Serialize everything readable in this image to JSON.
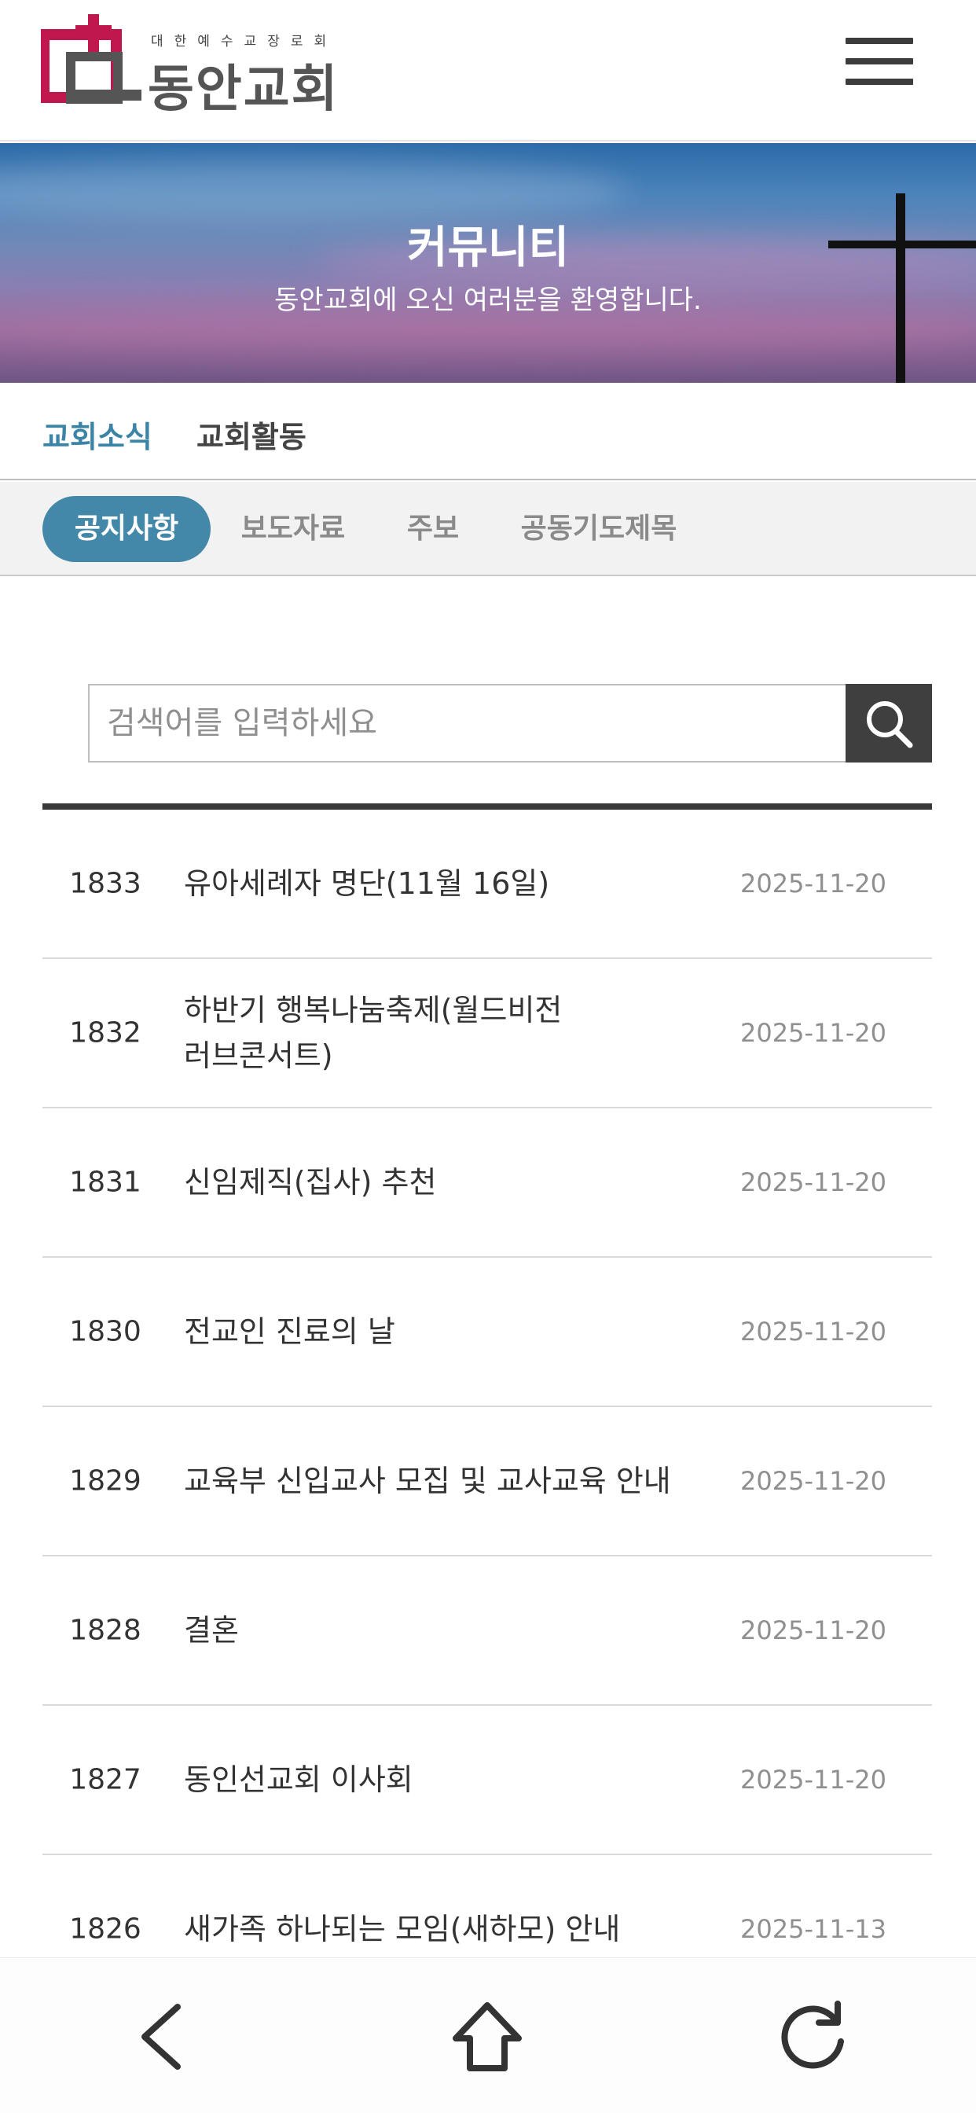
{
  "header": {
    "logo_small_text": "대한예수교장로회",
    "logo_text": "동안교회",
    "menu_icon": "hamburger-menu-icon"
  },
  "banner": {
    "title": "커뮤니티",
    "subtitle": "동안교회에 오신 여러분을 환영합니다."
  },
  "primary_tabs": [
    {
      "label": "교회소식",
      "active": true
    },
    {
      "label": "교회활동",
      "active": false
    }
  ],
  "secondary_tabs": [
    {
      "label": "공지사항",
      "active": true
    },
    {
      "label": "보도자료",
      "active": false
    },
    {
      "label": "주보",
      "active": false
    },
    {
      "label": "공동기도제목",
      "active": false
    }
  ],
  "search": {
    "placeholder": "검색어를 입력하세요",
    "icon": "search-icon"
  },
  "notices": [
    {
      "no": "1833",
      "title": "유아세례자 명단(11월 16일)",
      "date": "2025-11-20"
    },
    {
      "no": "1832",
      "title": "하반기 행복나눔축제(월드비전 러브콘서트)",
      "date": "2025-11-20"
    },
    {
      "no": "1831",
      "title": "신임제직(집사) 추천",
      "date": "2025-11-20"
    },
    {
      "no": "1830",
      "title": "전교인 진료의 날",
      "date": "2025-11-20"
    },
    {
      "no": "1829",
      "title": "교육부 신입교사 모집 및 교사교육 안내",
      "date": "2025-11-20"
    },
    {
      "no": "1828",
      "title": "결혼",
      "date": "2025-11-20"
    },
    {
      "no": "1827",
      "title": "동인선교회 이사회",
      "date": "2025-11-20"
    },
    {
      "no": "1826",
      "title": "새가족 하나되는 모임(새하모) 안내",
      "date": "2025-11-13"
    }
  ],
  "bottom_nav": {
    "back_icon": "back-arrow-icon",
    "home_icon": "home-icon",
    "refresh_icon": "refresh-icon"
  },
  "colors": {
    "accent": "#4388a8",
    "logo_red": "#c0174f",
    "dark": "#3f3f3f"
  }
}
